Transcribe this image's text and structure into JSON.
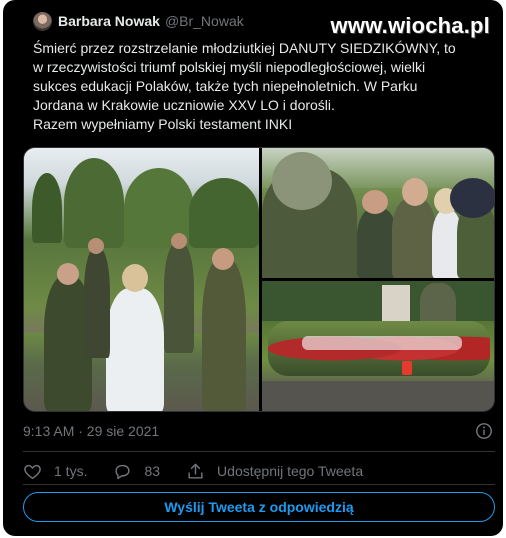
{
  "tweet": {
    "author_name": "Barbara Nowak",
    "author_handle": "@Br_Nowak",
    "text_lines": [
      "Śmierć przez rozstrzelanie młodziutkiej DANUTY SIEDZIKÓWNY, to",
      "w rzeczywistości triumf polskiej myśli niepodległościowej, wielki",
      "sukces edukacji Polaków, także tych niepełnoletnich. W Parku",
      "Jordana w Krakowie uczniowie XXV LO i dorośli.",
      "Razem wypełniamy Polski testament INKI"
    ],
    "timestamp": "9:13 AM · 29 sie 2021"
  },
  "watermark": "www.wiocha.pl",
  "actions": {
    "like_count": "1 tys.",
    "reply_count": "83",
    "share_label": "Udostępnij tego Tweeta"
  },
  "reply_button_label": "Wyślij Tweeta z odpowiedzią",
  "icons": {
    "like": "heart-icon",
    "reply": "speech-bubble-icon",
    "share": "share-upload-icon",
    "info": "info-icon"
  },
  "colors": {
    "background": "#000000",
    "text": "#e7e9ea",
    "muted": "#71767b",
    "accent": "#1d9bf0",
    "border": "#2f3336"
  }
}
